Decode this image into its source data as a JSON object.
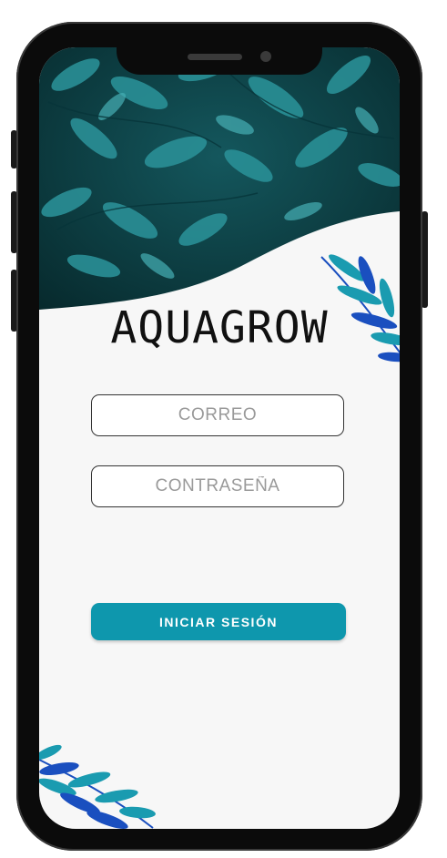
{
  "app": {
    "title": "AQUAGROW"
  },
  "login": {
    "email_placeholder": "CORREO",
    "password_placeholder": "CONTRASEÑA",
    "submit_label": "INICIAR SESIÓN"
  },
  "colors": {
    "accent": "#0e97ad",
    "hero_dark": "#0a3a3f",
    "leaf_teal": "#1a9bb0",
    "leaf_blue": "#1a4fbf"
  },
  "icons": {
    "hero_image": "leaves-photo",
    "decor_right": "leaf-branch-icon",
    "decor_left": "leaf-branch-icon"
  }
}
